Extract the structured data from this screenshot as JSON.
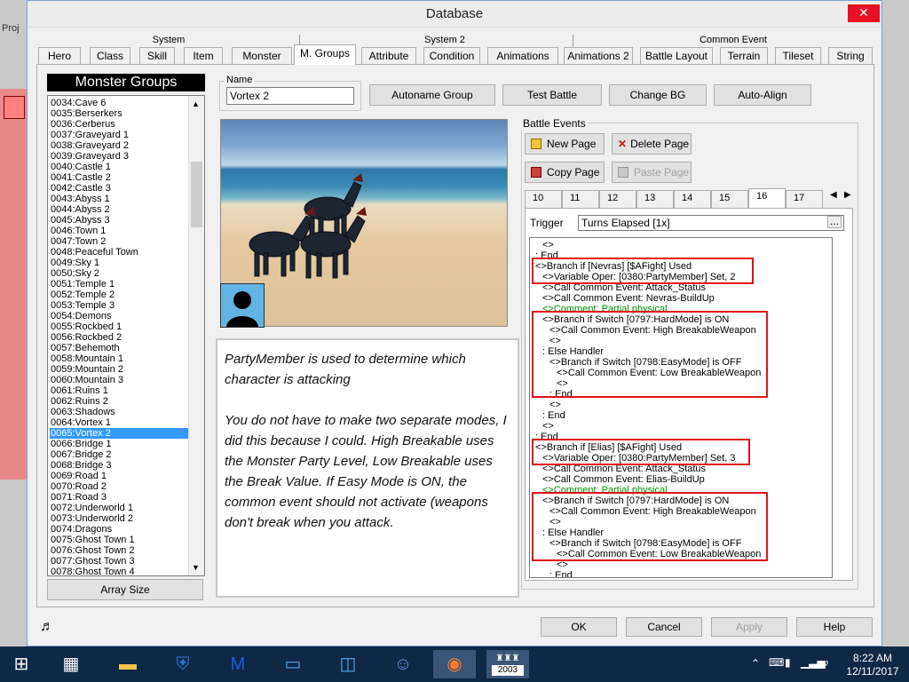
{
  "window": {
    "title": "Database"
  },
  "background_app": {
    "menu_label": "Proj"
  },
  "tab_groups": [
    "System",
    "System 2",
    "Common Event"
  ],
  "tabs": [
    {
      "label": "Hero"
    },
    {
      "label": "Class"
    },
    {
      "label": "Skill"
    },
    {
      "label": "Item"
    },
    {
      "label": "Monster"
    },
    {
      "label": "M. Groups"
    },
    {
      "label": "Attribute"
    },
    {
      "label": "Condition"
    },
    {
      "label": "Animations"
    },
    {
      "label": "Animations 2"
    },
    {
      "label": "Battle Layout"
    },
    {
      "label": "Terrain"
    },
    {
      "label": "Tileset"
    },
    {
      "label": "String"
    }
  ],
  "monster_groups": {
    "header": "Monster Groups",
    "selected": "0065:Vortex 2",
    "items": [
      "0034:Cave 6",
      "0035:Berserkers",
      "0036:Cerberus",
      "0037:Graveyard 1",
      "0038:Graveyard 2",
      "0039:Graveyard 3",
      "0040:Castle 1",
      "0041:Castle 2",
      "0042:Castle 3",
      "0043:Abyss 1",
      "0044:Abyss 2",
      "0045:Abyss 3",
      "0046:Town 1",
      "0047:Town 2",
      "0048:Peaceful Town",
      "0049:Sky 1",
      "0050:Sky 2",
      "0051:Temple 1",
      "0052:Temple 2",
      "0053:Temple 3",
      "0054:Demons",
      "0055:Rockbed 1",
      "0056:Rockbed 2",
      "0057:Behemoth",
      "0058:Mountain 1",
      "0059:Mountain 2",
      "0060:Mountain 3",
      "0061:Ruins 1",
      "0062:Ruins 2",
      "0063:Shadows",
      "0064:Vortex 1",
      "0065:Vortex 2",
      "0066:Bridge 1",
      "0067:Bridge 2",
      "0068:Bridge 3",
      "0069:Road 1",
      "0070:Road 2",
      "0071:Road 3",
      "0072:Underworld 1",
      "0073:Underworld 2",
      "0074:Dragons",
      "0075:Ghost Town 1",
      "0076:Ghost Town 2",
      "0077:Ghost Town 3",
      "0078:Ghost Town 4"
    ],
    "array_size_label": "Array Size"
  },
  "name_field": {
    "label": "Name",
    "value": "Vortex 2"
  },
  "toolbar": {
    "autoname": "Autoname Group",
    "test_battle": "Test Battle",
    "change_bg": "Change BG",
    "auto_align": "Auto-Align"
  },
  "note": {
    "paragraph1": "PartyMember is used to determine which character is attacking",
    "paragraph2": "You do not have to make two separate modes, I did this because I could. High Breakable uses the Monster Party Level, Low Breakable uses the Break Value. If Easy Mode is ON, the common event should not activate (weapons don't break when you attack."
  },
  "battle_events": {
    "label": "Battle Events",
    "new_page": "New Page",
    "delete_page": "Delete Page",
    "copy_page": "Copy Page",
    "paste_page": "Paste Page",
    "pages": [
      "10",
      "11",
      "12",
      "13",
      "14",
      "15",
      "16",
      "17"
    ],
    "selected_page": "16",
    "trigger_label": "Trigger",
    "trigger_value": "Turns Elapsed [1x]",
    "trigger_button": "...",
    "lines": [
      {
        "text": "<>",
        "indent": 1,
        "comment": false
      },
      {
        "text": ": End",
        "indent": 0,
        "comment": false
      },
      {
        "text": "<>Branch if [Nevras]  [$AFight] Used",
        "indent": 0,
        "comment": false
      },
      {
        "text": "<>Variable Oper: [0380:PartyMember] Set, 2",
        "indent": 1,
        "comment": false
      },
      {
        "text": "<>Call Common Event: Attack_Status",
        "indent": 1,
        "comment": false
      },
      {
        "text": "<>Call Common Event: Nevras-BuildUp",
        "indent": 1,
        "comment": false
      },
      {
        "text": "<>Comment: Partial physical",
        "indent": 1,
        "comment": true
      },
      {
        "text": "<>Branch if  Switch [0797:HardMode] is ON",
        "indent": 1,
        "comment": false
      },
      {
        "text": "<>Call Common Event: High BreakableWeapon",
        "indent": 2,
        "comment": false
      },
      {
        "text": "<>",
        "indent": 2,
        "comment": false
      },
      {
        "text": ": Else Handler",
        "indent": 1,
        "comment": false
      },
      {
        "text": "<>Branch if  Switch [0798:EasyMode] is OFF",
        "indent": 2,
        "comment": false
      },
      {
        "text": "<>Call Common Event: Low BreakableWeapon",
        "indent": 3,
        "comment": false
      },
      {
        "text": "<>",
        "indent": 3,
        "comment": false
      },
      {
        "text": ": End",
        "indent": 2,
        "comment": false
      },
      {
        "text": "<>",
        "indent": 2,
        "comment": false
      },
      {
        "text": ": End",
        "indent": 1,
        "comment": false
      },
      {
        "text": "<>",
        "indent": 1,
        "comment": false
      },
      {
        "text": ": End",
        "indent": 0,
        "comment": false
      },
      {
        "text": "<>Branch if [Elias]  [$AFight] Used",
        "indent": 0,
        "comment": false
      },
      {
        "text": "<>Variable Oper: [0380:PartyMember] Set, 3",
        "indent": 1,
        "comment": false
      },
      {
        "text": "<>Call Common Event: Attack_Status",
        "indent": 1,
        "comment": false
      },
      {
        "text": "<>Call Common Event: Elias-BuildUp",
        "indent": 1,
        "comment": false
      },
      {
        "text": "<>Comment: Partial physical",
        "indent": 1,
        "comment": true
      },
      {
        "text": "<>Branch if  Switch [0797:HardMode] is ON",
        "indent": 1,
        "comment": false
      },
      {
        "text": "<>Call Common Event: High BreakableWeapon",
        "indent": 2,
        "comment": false
      },
      {
        "text": "<>",
        "indent": 2,
        "comment": false
      },
      {
        "text": ": Else Handler",
        "indent": 1,
        "comment": false
      },
      {
        "text": "<>Branch if  Switch [0798:EasyMode] is OFF",
        "indent": 2,
        "comment": false
      },
      {
        "text": "<>Call Common Event: Low BreakableWeapon",
        "indent": 3,
        "comment": false
      },
      {
        "text": "<>",
        "indent": 3,
        "comment": false
      },
      {
        "text": ": End",
        "indent": 2,
        "comment": false
      }
    ]
  },
  "footer": {
    "ok": "OK",
    "cancel": "Cancel",
    "apply": "Apply",
    "help": "Help"
  },
  "taskbar": {
    "time": "8:22 AM",
    "date": "12/11/2017",
    "rpgmaker_badge": "2003"
  },
  "colors": {
    "highlight_red": "#e0101a",
    "selection_blue": "#3399ff",
    "comment_green": "#009000"
  }
}
